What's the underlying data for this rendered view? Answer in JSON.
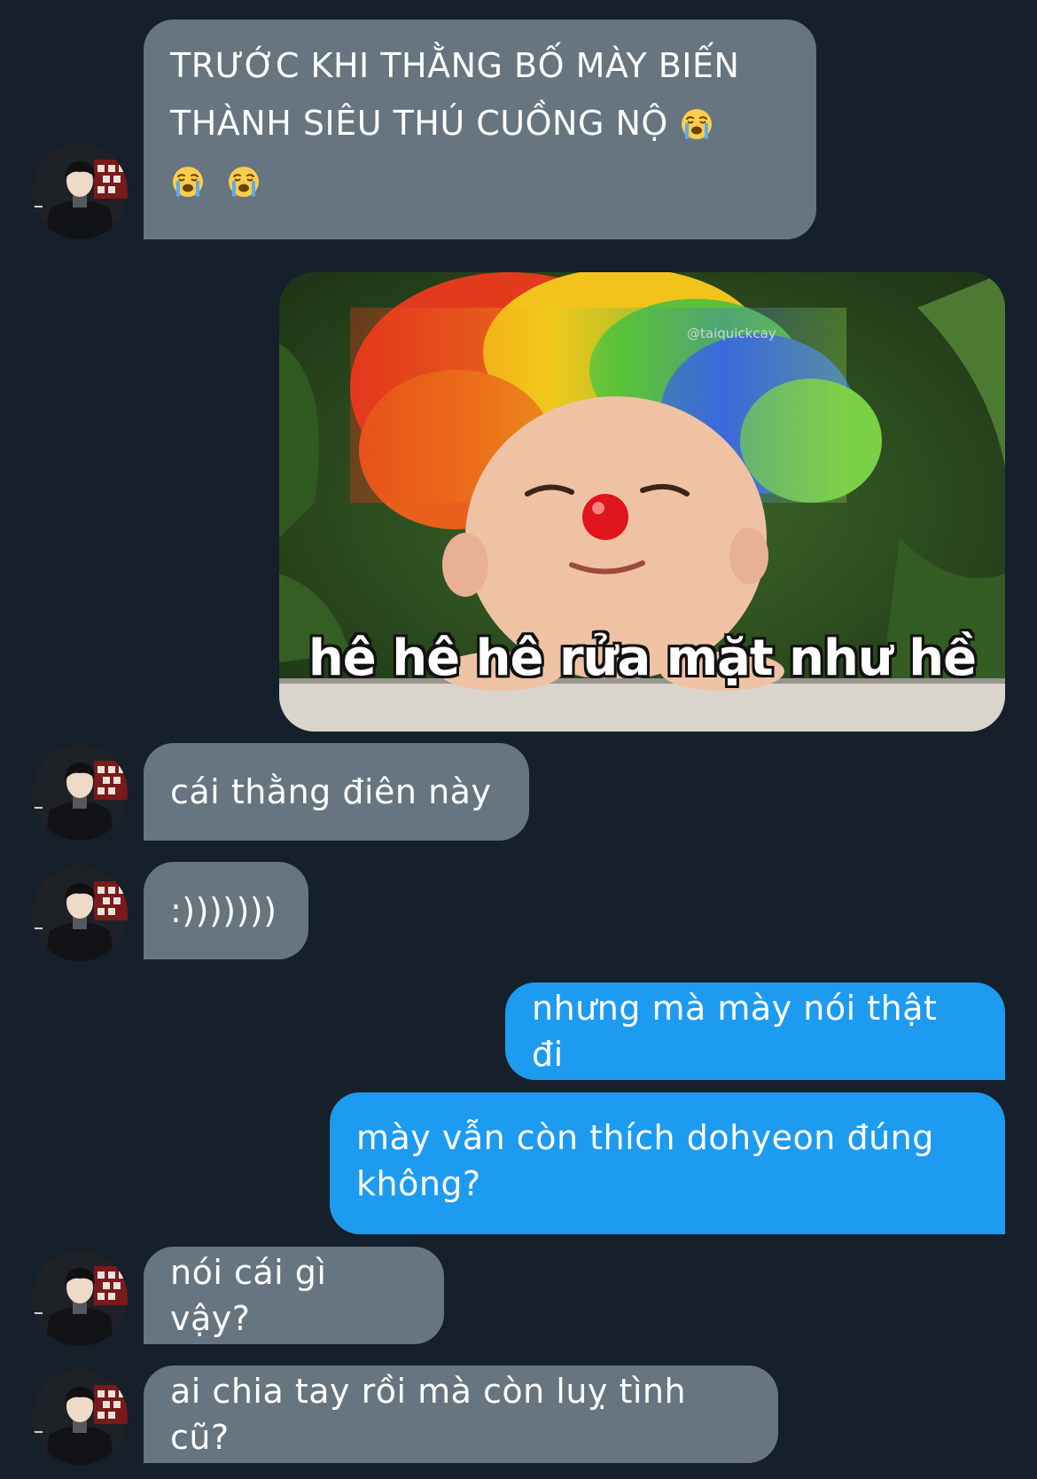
{
  "conversation": {
    "messages": [
      {
        "from": "contact",
        "lines": [
          "TRƯỚC KHI THẰNG BỐ MÀY BIẾN",
          "THÀNH SIÊU THÚ CUỒNG NỘ",
          ""
        ],
        "emoji": "loudly-crying-face"
      },
      {
        "from": "me",
        "type": "image",
        "image_caption": "hê hê hê rửa mặt như hề",
        "image_watermark": "@taiquickcay"
      },
      {
        "from": "contact",
        "text": "cái thằng điên này"
      },
      {
        "from": "contact",
        "text": ":)))))))"
      },
      {
        "from": "me",
        "text": "nhưng mà mày nói thật đi"
      },
      {
        "from": "me",
        "lines": [
          "mày vẫn còn thích dohyeon đúng",
          "không?"
        ]
      },
      {
        "from": "contact",
        "text": "nói cái gì vậy?"
      },
      {
        "from": "contact",
        "text": "ai chia tay rồi mà còn luỵ tình cũ?"
      }
    ]
  },
  "colors": {
    "background": "#15202b",
    "incoming_bubble": "#66757f",
    "outgoing_bubble": "#1d9bf0"
  }
}
